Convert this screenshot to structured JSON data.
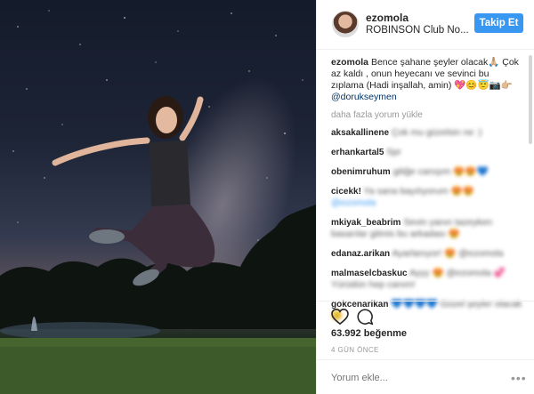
{
  "post": {
    "username": "ezomola",
    "location": "ROBINSON Club No...",
    "follow_label": "Takip Et",
    "caption_user": "ezomola",
    "caption_text": "Bence şahane şeyler olacak🙏🏼 Çok az kaldı , onun heyecanı ve sevinci bu zıplama (Hadi inşallah, amin) 💖😊😇📷👉🏼",
    "caption_mention": "@dorukseymen",
    "load_more": "daha fazla yorum yükle",
    "comments": [
      {
        "user": "aksakallinene",
        "text": "Çok mu güzelsin ne :)"
      },
      {
        "user": "erhankartal5",
        "text": "Spr"
      },
      {
        "user": "obenimruhum",
        "text": "gitiğe canışım 😍😍💙"
      },
      {
        "user": "cicekk!",
        "text": "Ya sana bayılıyorum 😍😍",
        "mention": "@ezomola"
      },
      {
        "user": "mkiyak_beabrim",
        "text": "Sevin yanın tazeyken basarılar gitmis bu arkadası 😍"
      },
      {
        "user": "edanaz.arikan",
        "text": "Ayarlanıyor! 😍 @ezomola"
      },
      {
        "user": "malmaselcbaskuc",
        "text": "Ayyy 😍 @ezomola 💞 Yürüdün hep canım!"
      },
      {
        "user": "gokcenarikan",
        "text": "💙💙💙💙 Güzel şeyler olacak 😊"
      }
    ],
    "likes": "63.992 beğenme",
    "date": "4 GÜN ÖNCE",
    "comment_placeholder": "Yorum ekle...",
    "more_options": "•••"
  },
  "icons": {
    "like": "heart-icon",
    "comment": "comment-icon"
  },
  "colors": {
    "accent": "#3897f0",
    "link": "#003569"
  }
}
